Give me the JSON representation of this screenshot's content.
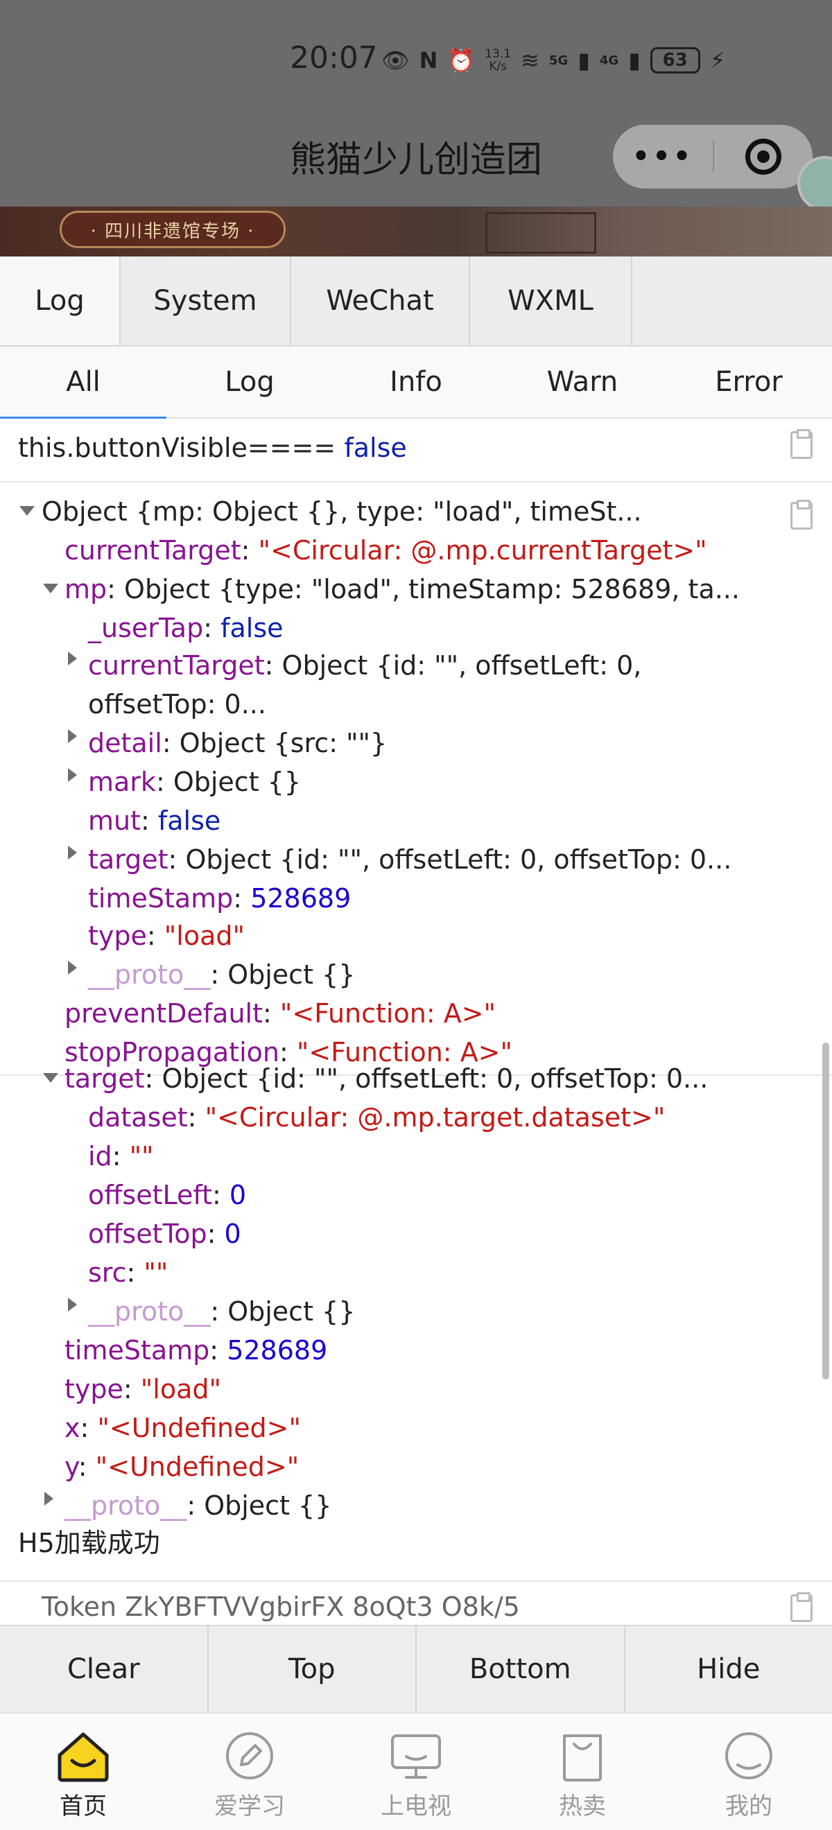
{
  "status": {
    "time": "20:07",
    "net_speed_value": "13.1",
    "net_speed_unit": "K/s",
    "signal1": "5G",
    "signal2": "4G",
    "battery": "63"
  },
  "app": {
    "title": "熊猫少儿创造团",
    "banner_tag": "· 四川非遗馆专场 ·"
  },
  "tabs": [
    "Log",
    "System",
    "WeChat",
    "WXML"
  ],
  "subtabs": [
    "All",
    "Log",
    "Info",
    "Warn",
    "Error"
  ],
  "log": {
    "entry1": {
      "label": "this.buttonVisible====",
      "value": "false"
    },
    "obj": {
      "summary": "Object {mp: Object {}, type: \"load\", timeSt...",
      "currentTarget_key": "currentTarget",
      "currentTarget_val": "\"<Circular: @.mp.currentTarget>\"",
      "mp_key": "mp",
      "mp_val": "Object {type: \"load\", timeStamp: 528689, ta...",
      "userTap_key": "_userTap",
      "userTap_val": "false",
      "mp_ct_key": "currentTarget",
      "mp_ct_val": "Object {id: \"\", offsetLeft: 0,",
      "mp_ct_val2": "offsetTop: 0...",
      "detail_key": "detail",
      "detail_val": "Object {src: \"\"}",
      "mark_key": "mark",
      "mark_val": "Object {}",
      "mut_key": "mut",
      "mut_val": "false",
      "mp_target_key": "target",
      "mp_target_val": "Object {id: \"\", offsetLeft: 0, offsetTop: 0...",
      "mp_ts_key": "timeStamp",
      "mp_ts_val": "528689",
      "mp_type_key": "type",
      "mp_type_val": "\"load\"",
      "mp_proto_key": "__proto__",
      "mp_proto_val": "Object {}",
      "pd_key": "preventDefault",
      "pd_val": "\"<Function: A>\"",
      "sp_key": "stopPropagation",
      "sp_val": "\"<Function: A>\"",
      "target_key": "target",
      "target_val": "Object {id: \"\", offsetLeft: 0, offsetTop: 0...",
      "dataset_key": "dataset",
      "dataset_val": "\"<Circular: @.mp.target.dataset>\"",
      "id_key": "id",
      "id_val": "\"\"",
      "ol_key": "offsetLeft",
      "ol_val": "0",
      "ot_key": "offsetTop",
      "ot_val": "0",
      "src_key": "src",
      "src_val": "\"\"",
      "t_proto_key": "__proto__",
      "t_proto_val": "Object {}",
      "ts_key": "timeStamp",
      "ts_val": "528689",
      "type_key": "type",
      "type_val": "\"load\"",
      "x_key": "x",
      "x_val": "\"<Undefined>\"",
      "y_key": "y",
      "y_val": "\"<Undefined>\"",
      "proto_key": "__proto__",
      "proto_val": "Object {}"
    },
    "entry3": "H5加载成功",
    "entry4_partial": "Token  ZkYBFTVVgbirFX  8oQt3  O8k/5"
  },
  "toolbar": [
    "Clear",
    "Top",
    "Bottom",
    "Hide"
  ],
  "nav": [
    {
      "label": "首页",
      "icon": "home-icon"
    },
    {
      "label": "爱学习",
      "icon": "pencil-icon"
    },
    {
      "label": "上电视",
      "icon": "tv-icon"
    },
    {
      "label": "热卖",
      "icon": "bag-icon"
    },
    {
      "label": "我的",
      "icon": "profile-icon"
    }
  ],
  "colors": {
    "accent": "#3a8ee6",
    "home_yellow": "#f7d21e"
  }
}
